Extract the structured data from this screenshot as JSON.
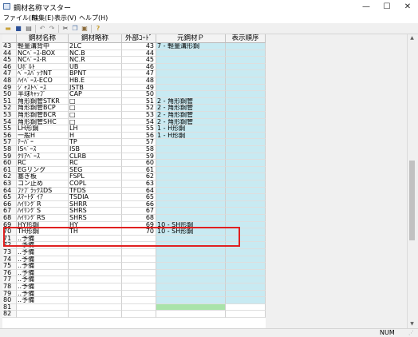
{
  "window": {
    "title": "鋼材名称マスター",
    "minimize": "—",
    "maximize": "☐",
    "close": "✕"
  },
  "menu": [
    "ファイル(F)",
    "編集(E)",
    "表示(V)",
    "ヘルプ(H)"
  ],
  "toolbar": [
    "open-icon",
    "save-icon",
    "print-icon",
    "undo-icon",
    "redo-icon",
    "cut-icon",
    "copy-icon",
    "paste-icon",
    "help-icon"
  ],
  "columns": [
    "",
    "鋼材名称",
    "鋼材略称",
    "外部ｺｰﾄﾞ",
    "元鋼材Ｐ",
    "表示順序"
  ],
  "rows": [
    [
      "43",
      "軽量溝背中",
      "2LC",
      "43",
      "7 - 軽量溝形鋼",
      ""
    ],
    [
      "44",
      "NCﾍﾞｰｽ-BOX",
      "NC.B",
      "44",
      "",
      ""
    ],
    [
      "45",
      "NCﾍﾞｰｽ-R",
      "NC.R",
      "45",
      "",
      ""
    ],
    [
      "46",
      "Uﾎﾞﾙﾄ",
      "UB",
      "46",
      "",
      ""
    ],
    [
      "47",
      "ﾍﾞｰｽﾊﾟｯｸNT",
      "BPNT",
      "47",
      "",
      ""
    ],
    [
      "48",
      "ﾊｲﾍﾞｰｽ-ECO",
      "HB.E",
      "48",
      "",
      ""
    ],
    [
      "49",
      "ｼﾞｬｽﾄﾍﾞｰｽ",
      "JSTB",
      "49",
      "",
      ""
    ],
    [
      "50",
      "半球ｷｬｯﾌﾟ",
      "CAP",
      "50",
      "",
      ""
    ],
    [
      "51",
      "角形鋼管STKR",
      "□",
      "51",
      "2 - 角形鋼管",
      ""
    ],
    [
      "52",
      "角形鋼管BCP",
      "□",
      "52",
      "2 - 角形鋼管",
      ""
    ],
    [
      "53",
      "角形鋼管BCR",
      "□",
      "53",
      "2 - 角形鋼管",
      ""
    ],
    [
      "54",
      "角形鋼管SHC",
      "□",
      "54",
      "2 - 角形鋼管",
      ""
    ],
    [
      "55",
      "LH形鋼",
      "LH",
      "55",
      "1 - H形鋼",
      ""
    ],
    [
      "56",
      "一般H",
      "H",
      "56",
      "1 - H形鋼",
      ""
    ],
    [
      "57",
      "ﾃｰﾊﾟｰ",
      "TP",
      "57",
      "",
      ""
    ],
    [
      "58",
      "ISﾍﾞｰｽ",
      "ISB",
      "58",
      "",
      ""
    ],
    [
      "59",
      "ｸﾘｱﾍﾞｰｽ",
      "CLRB",
      "59",
      "",
      ""
    ],
    [
      "60",
      "RC",
      "RC",
      "60",
      "",
      ""
    ],
    [
      "61",
      "EGリング",
      "SEG",
      "61",
      "",
      ""
    ],
    [
      "62",
      "塞ぎ板",
      "FSPL",
      "62",
      "",
      ""
    ],
    [
      "63",
      "コン止め",
      "COPL",
      "63",
      "",
      ""
    ],
    [
      "64",
      "ﾌｧﾌﾞﾗｯｸｽDS",
      "TFDS",
      "64",
      "",
      ""
    ],
    [
      "65",
      "ｽﾏｰﾄﾀﾞｲｱ",
      "TSDIA",
      "65",
      "",
      ""
    ],
    [
      "66",
      "ﾊｲﾘﾝｸﾞR",
      "SHRR",
      "66",
      "",
      ""
    ],
    [
      "67",
      "ﾊｲﾘﾝｸﾞS",
      "SHRS",
      "67",
      "",
      ""
    ],
    [
      "68",
      "ﾊｲﾘﾝｸﾞRS",
      "SHRS",
      "68",
      "",
      ""
    ],
    [
      "69",
      "HY形鋼",
      "HY",
      "69",
      "10 - SH形鋼",
      ""
    ],
    [
      "70",
      "TH形鋼",
      "TH",
      "70",
      "10 - SH形鋼",
      ""
    ],
    [
      "71",
      "..予備",
      "",
      "",
      "",
      ""
    ],
    [
      "72",
      "..予備",
      "",
      "",
      "",
      ""
    ],
    [
      "73",
      "..予備",
      "",
      "",
      "",
      ""
    ],
    [
      "74",
      "..予備",
      "",
      "",
      "",
      ""
    ],
    [
      "75",
      "..予備",
      "",
      "",
      "",
      ""
    ],
    [
      "76",
      "..予備",
      "",
      "",
      "",
      ""
    ],
    [
      "77",
      "..予備",
      "",
      "",
      "",
      ""
    ],
    [
      "78",
      "..予備",
      "",
      "",
      "",
      ""
    ],
    [
      "79",
      "..予備",
      "",
      "",
      "",
      ""
    ],
    [
      "80",
      "..予備",
      "",
      "",
      "",
      ""
    ],
    [
      "81",
      "",
      "",
      "",
      "",
      ""
    ],
    [
      "82",
      "",
      "",
      "",
      "",
      ""
    ]
  ],
  "highlight_rows": [
    "69",
    "70"
  ],
  "status": {
    "num": "NUM"
  },
  "colors": {
    "cyan": "#c8eaf2",
    "green": "#a9e3a9",
    "highlight": "#e02020"
  }
}
